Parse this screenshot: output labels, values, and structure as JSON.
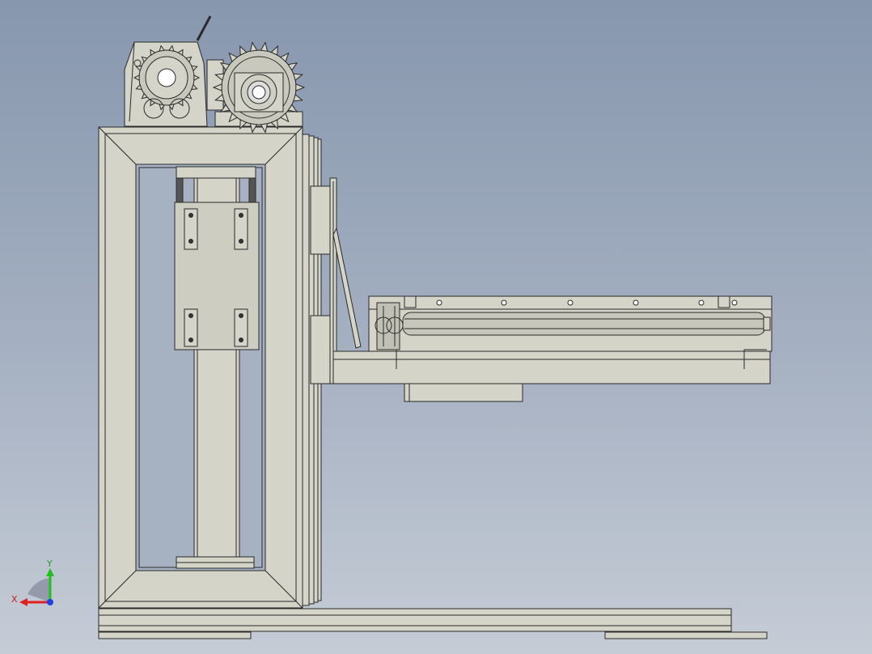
{
  "viewport": {
    "background_top": "#8797ae",
    "background_bottom": "#c5ccd6",
    "part_fill": "#d4d4c8",
    "part_shade": "#b9b9ab",
    "edge_color": "#2a2a2a"
  },
  "triad": {
    "x_label": "X",
    "y_label": "Y",
    "x_color": "#e02020",
    "y_color": "#20c020",
    "z_color": "#2040e0"
  },
  "components": [
    "base-frame",
    "gear-motor",
    "sprocket-drive",
    "vertical-rail",
    "carriage",
    "cantilever-arm",
    "roller"
  ]
}
